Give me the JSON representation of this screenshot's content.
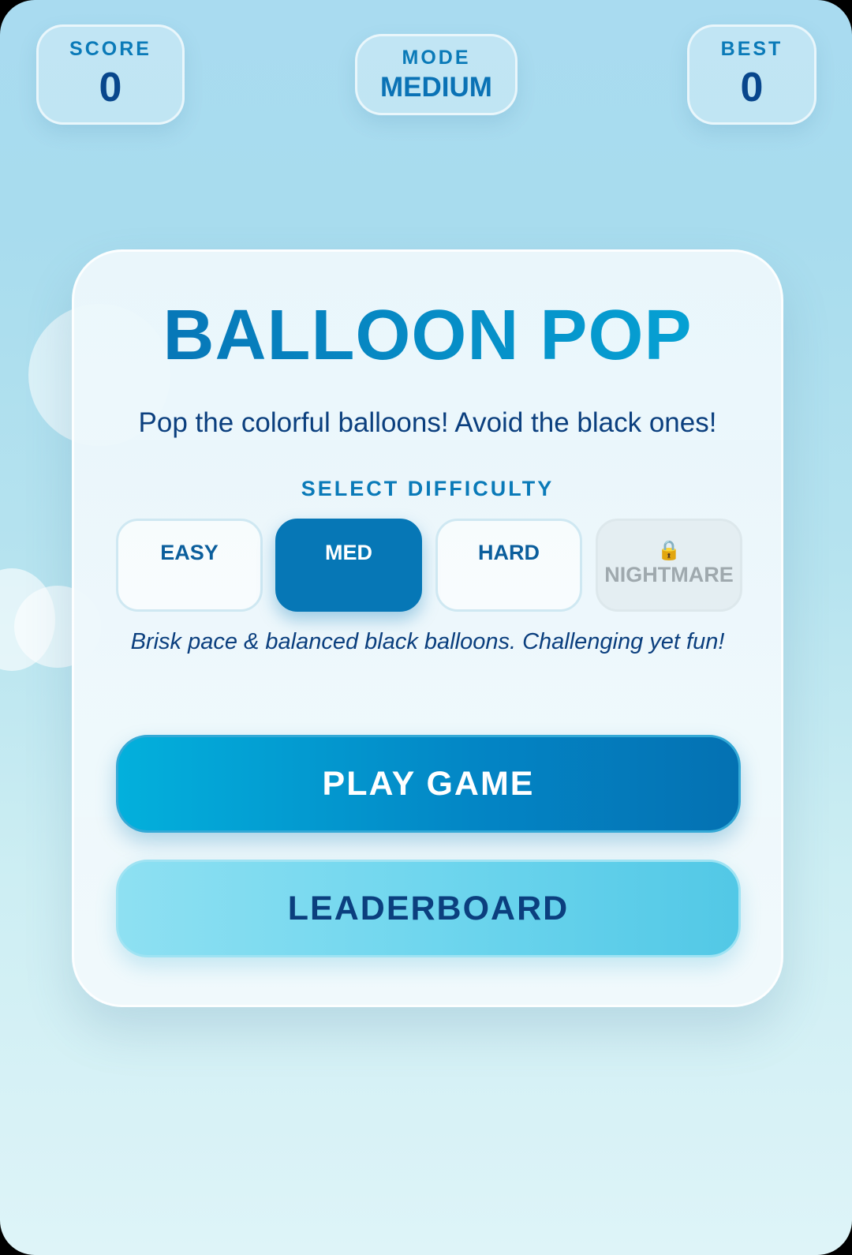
{
  "hud": {
    "score_label": "SCORE",
    "score_value": "0",
    "mode_label": "MODE",
    "mode_value": "MEDIUM",
    "best_label": "BEST",
    "best_value": "0"
  },
  "menu": {
    "title": "BALLOON POP",
    "subtitle": "Pop the colorful balloons! Avoid the black ones!",
    "difficulty_label": "SELECT DIFFICULTY",
    "difficulties": [
      {
        "label": "EASY",
        "selected": false,
        "locked": false
      },
      {
        "label": "MED",
        "selected": true,
        "locked": false
      },
      {
        "label": "HARD",
        "selected": false,
        "locked": false
      },
      {
        "label": "NIGHTMARE",
        "selected": false,
        "locked": true,
        "icon": "lock-icon"
      }
    ],
    "description": "Brisk pace & balanced black balloons. Challenging yet fun!",
    "play_label": "PLAY GAME",
    "leaderboard_label": "LEADERBOARD"
  },
  "colors": {
    "accent": "#0677b6",
    "title_gradient_start": "#0770b3",
    "title_gradient_end": "#06a8d8",
    "text_dark": "#0b3f7e",
    "leaderboard": "#6fd6ee",
    "locked": "#9fa9ae"
  }
}
